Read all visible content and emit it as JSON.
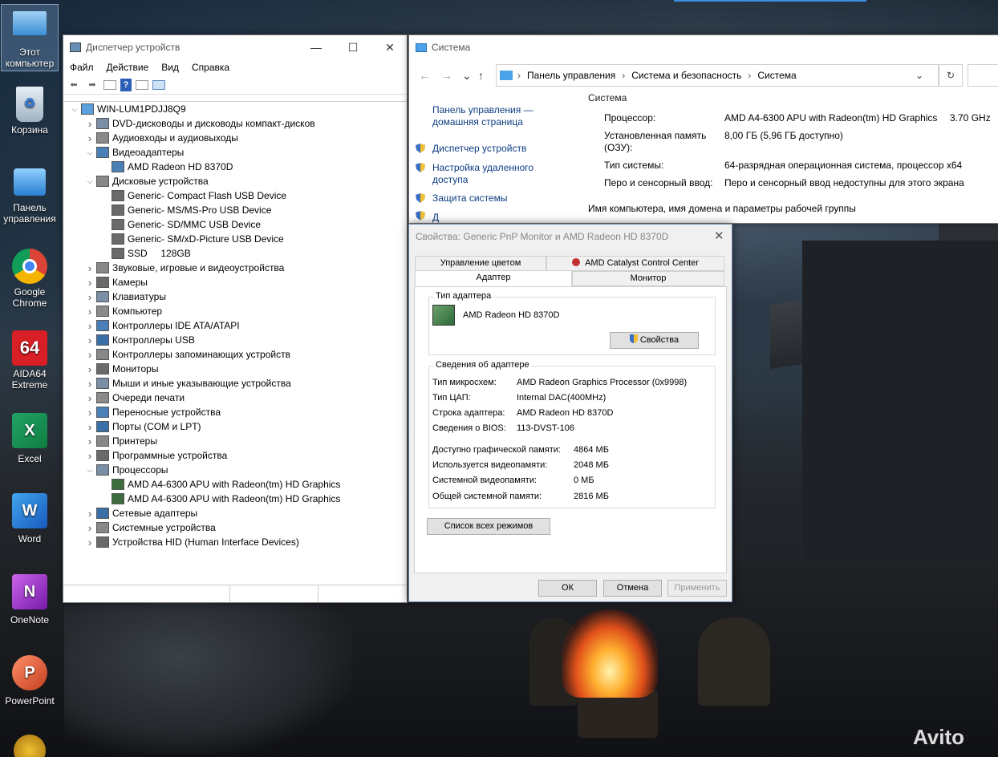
{
  "desktop": {
    "icons": [
      {
        "label": "Этот компьютер",
        "icon": "computer-icon"
      },
      {
        "label": "Корзина",
        "icon": "recycle-bin-icon"
      },
      {
        "label": "Панель управления",
        "icon": "control-panel-icon"
      },
      {
        "label": "Google Chrome",
        "icon": "chrome-icon"
      },
      {
        "label": "AIDA64 Extreme",
        "icon": "aida64-icon"
      },
      {
        "label": "Excel",
        "icon": "excel-icon"
      },
      {
        "label": "Word",
        "icon": "word-icon"
      },
      {
        "label": "OneNote",
        "icon": "onenote-icon"
      },
      {
        "label": "PowerPoint",
        "icon": "powerpoint-icon"
      }
    ],
    "watermark": "Avito"
  },
  "device_manager": {
    "title": "Диспетчер устройств",
    "menu": [
      "Файл",
      "Действие",
      "Вид",
      "Справка"
    ],
    "root": "WIN-LUM1PDJJ8Q9",
    "items": [
      {
        "label": "DVD-дисководы и дисководы компакт-дисков",
        "level": 1,
        "state": "collapsed"
      },
      {
        "label": "Аудиовходы и аудиовыходы",
        "level": 1,
        "state": "collapsed"
      },
      {
        "label": "Видеоадаптеры",
        "level": 1,
        "state": "expanded"
      },
      {
        "label": "AMD Radeon HD 8370D",
        "level": 2,
        "state": "leaf"
      },
      {
        "label": "Дисковые устройства",
        "level": 1,
        "state": "expanded"
      },
      {
        "label": "Generic- Compact Flash USB Device",
        "level": 2,
        "state": "leaf"
      },
      {
        "label": "Generic- MS/MS-Pro USB Device",
        "level": 2,
        "state": "leaf"
      },
      {
        "label": "Generic- SD/MMC USB Device",
        "level": 2,
        "state": "leaf"
      },
      {
        "label": "Generic- SM/xD-Picture USB Device",
        "level": 2,
        "state": "leaf"
      },
      {
        "label": "SSD     128GB",
        "level": 2,
        "state": "leaf"
      },
      {
        "label": "Звуковые, игровые и видеоустройства",
        "level": 1,
        "state": "collapsed"
      },
      {
        "label": "Камеры",
        "level": 1,
        "state": "collapsed"
      },
      {
        "label": "Клавиатуры",
        "level": 1,
        "state": "collapsed"
      },
      {
        "label": "Компьютер",
        "level": 1,
        "state": "collapsed"
      },
      {
        "label": "Контроллеры IDE ATA/ATAPI",
        "level": 1,
        "state": "collapsed"
      },
      {
        "label": "Контроллеры USB",
        "level": 1,
        "state": "collapsed"
      },
      {
        "label": "Контроллеры запоминающих устройств",
        "level": 1,
        "state": "collapsed"
      },
      {
        "label": "Мониторы",
        "level": 1,
        "state": "collapsed"
      },
      {
        "label": "Мыши и иные указывающие устройства",
        "level": 1,
        "state": "collapsed"
      },
      {
        "label": "Очереди печати",
        "level": 1,
        "state": "collapsed"
      },
      {
        "label": "Переносные устройства",
        "level": 1,
        "state": "collapsed"
      },
      {
        "label": "Порты (COM и LPT)",
        "level": 1,
        "state": "collapsed"
      },
      {
        "label": "Принтеры",
        "level": 1,
        "state": "collapsed"
      },
      {
        "label": "Программные устройства",
        "level": 1,
        "state": "collapsed"
      },
      {
        "label": "Процессоры",
        "level": 1,
        "state": "expanded"
      },
      {
        "label": "AMD A4-6300 APU with Radeon(tm) HD Graphics",
        "level": 2,
        "state": "leaf"
      },
      {
        "label": "AMD A4-6300 APU with Radeon(tm) HD Graphics",
        "level": 2,
        "state": "leaf"
      },
      {
        "label": "Сетевые адаптеры",
        "level": 1,
        "state": "collapsed"
      },
      {
        "label": "Системные устройства",
        "level": 1,
        "state": "collapsed"
      },
      {
        "label": "Устройства HID (Human Interface Devices)",
        "level": 1,
        "state": "collapsed"
      }
    ]
  },
  "system_window": {
    "title": "Система",
    "breadcrumb": [
      "Панель управления",
      "Система и безопасность",
      "Система"
    ],
    "sidebar": {
      "home": "Панель управления — домашняя страница",
      "links": [
        "Диспетчер устройств",
        "Настройка удаленного доступа",
        "Защита системы",
        "Д"
      ]
    },
    "section": "Система",
    "rows": [
      {
        "label": "Процессор:",
        "value": "AMD A4-6300 APU with Radeon(tm) HD Graphics",
        "extra": "3.70 GHz"
      },
      {
        "label": "Установленная память (ОЗУ):",
        "value": "8,00 ГБ (5,96 ГБ доступно)",
        "extra": ""
      },
      {
        "label": "Тип системы:",
        "value": "64-разрядная операционная система, процессор x64",
        "extra": ""
      },
      {
        "label": "Перо и сенсорный ввод:",
        "value": "Перо и сенсорный ввод недоступны для этого экрана",
        "extra": ""
      }
    ],
    "section2": "Имя компьютера, имя домена и параметры рабочей группы"
  },
  "dialog": {
    "title": "Свойства: Generic PnP Monitor и AMD Radeon HD 8370D",
    "tabs_back": [
      "Управление цветом",
      "AMD Catalyst Control Center"
    ],
    "tabs_front": [
      "Адаптер",
      "Монитор"
    ],
    "adapter_type_group": "Тип адаптера",
    "adapter_name": "AMD Radeon HD 8370D",
    "properties_button": "Свойства",
    "info_group": "Сведения об адаптере",
    "info": [
      {
        "label": "Тип микросхем:",
        "value": "AMD Radeon Graphics Processor (0x9998)"
      },
      {
        "label": "Тип ЦАП:",
        "value": "Internal DAC(400MHz)"
      },
      {
        "label": "Строка адаптера:",
        "value": "AMD Radeon HD 8370D"
      },
      {
        "label": "Сведения о BIOS:",
        "value": "113-DVST-106"
      }
    ],
    "memory": [
      {
        "label": "Доступно графической памяти:",
        "value": "4864 МБ"
      },
      {
        "label": "Используется видеопамяти:",
        "value": "2048 МБ"
      },
      {
        "label": "Системной видеопамяти:",
        "value": "0 МБ"
      },
      {
        "label": "Общей системной памяти:",
        "value": "2816 МБ"
      }
    ],
    "list_modes_button": "Список всех режимов",
    "ok": "ОК",
    "cancel": "Отмена",
    "apply": "Применить"
  }
}
